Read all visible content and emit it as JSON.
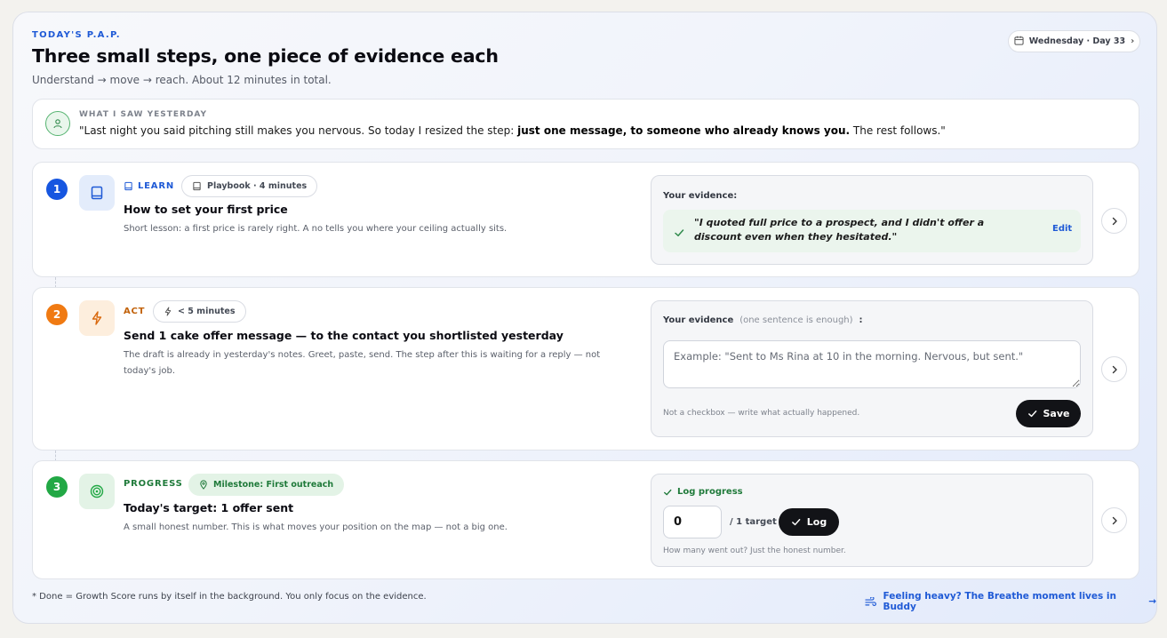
{
  "header": {
    "eyebrow": "TODAY'S P.A.P.",
    "title": "Three small steps, one piece of evidence each",
    "subtitle": "Understand → move → reach. About 12 minutes in total.",
    "day_label": "Wednesday · Day 33",
    "day_chevron": "›"
  },
  "saw": {
    "label": "WHAT I SAW YESTERDAY",
    "text_before": "\"Last night you said pitching still makes you nervous. So today I resized the step: ",
    "text_bold": "just one message, to someone who already knows you.",
    "text_after": " The rest follows.\""
  },
  "steps": [
    {
      "number": "1",
      "tag": "LEARN",
      "chip": "Playbook · 4 minutes",
      "title": "How to set your first price",
      "desc": "Short lesson: a first price is rarely right. A no tells you where your ceiling actually sits.",
      "evidence_label": "Your evidence:",
      "evidence_quote": "\"I quoted full price to a prospect, and I didn't offer a discount even when they hesitated.\"",
      "edit_label": "Edit"
    },
    {
      "number": "2",
      "tag": "ACT",
      "chip": "< 5 minutes",
      "title": "Send 1 cake offer message — to the contact you shortlisted yesterday",
      "desc": "The draft is already in yesterday's notes. Greet, paste, send. The step after this is waiting for a reply — not today's job.",
      "evidence_label": "Your evidence",
      "evidence_hint": "(one sentence is enough)",
      "evidence_colon": ":",
      "placeholder": "Example: \"Sent to Ms Rina at 10 in the morning. Nervous, but sent.\"",
      "note": "Not a checkbox — write what actually happened.",
      "save_label": "Save"
    },
    {
      "number": "3",
      "tag": "PROGRESS",
      "chip": "Milestone: First outreach",
      "title": "Today's target: 1 offer sent",
      "desc": "A small honest number. This is what moves your position on the map — not a big one.",
      "log_title": "Log progress",
      "log_value": "0",
      "log_of": "/ 1 target",
      "log_button": "Log",
      "log_note": "How many went out? Just the honest number."
    }
  ],
  "footer": {
    "left": "* Done = Growth Score runs by itself in the background. You only focus on the evidence.",
    "right": "Feeling heavy? The Breathe moment lives in Buddy",
    "right_arrow": "→"
  },
  "colors": {
    "accent_blue": "#1f5ad6",
    "step1": "#1656e0",
    "step2": "#f07a12",
    "step3": "#22a845",
    "tag_act": "#c2620a",
    "tag_progress": "#1f7a3a"
  }
}
